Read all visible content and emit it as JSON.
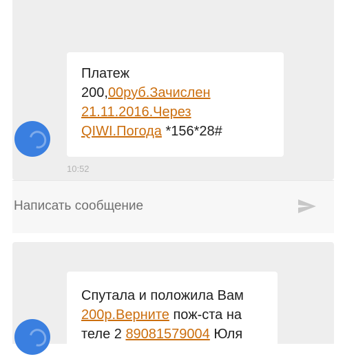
{
  "thread1": {
    "message": {
      "line1": "Платеж",
      "line2_plain": "200,",
      "line2_link": "00руб.Зачислен",
      "line3_link": "21.11.2016.Через",
      "line4_link": "QIWI.Погода",
      "line4_plain": " *156*28#"
    },
    "time": "10:52"
  },
  "compose": {
    "placeholder": "Написать сообщение",
    "send_icon": "send-icon"
  },
  "thread2": {
    "message": {
      "line1": "Спутала и положила Вам",
      "line2_link": "200р.Верните",
      "line2_plain": " пож-ста на",
      "line3_plain_a": "теле 2 ",
      "line3_link": "89081579004",
      "line3_plain_b": " Юля"
    }
  },
  "colors": {
    "link": "#cc6f0f",
    "avatar": "#3a7fe0",
    "panel": "#eeeeee"
  }
}
